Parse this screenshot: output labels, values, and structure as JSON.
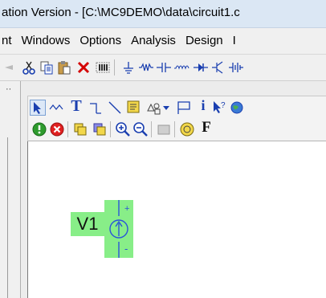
{
  "window": {
    "title": "ation Version - [C:\\MC9DEMO\\data\\circuit1.c"
  },
  "menu": {
    "items": [
      "nt",
      "Windows",
      "Options",
      "Analysis",
      "Design",
      "I"
    ]
  },
  "toolbar_main": {
    "icons": [
      "undo-icon",
      "cut-icon",
      "copy-icon",
      "paste-icon",
      "delete-icon",
      "select-all-icon",
      "ground-icon",
      "resistor-icon",
      "capacitor-icon",
      "inductor-icon",
      "diode-icon",
      "npn-transistor-icon",
      "battery-icon"
    ]
  },
  "toolbar_draw": {
    "icons": [
      "select-arrow-icon",
      "wire-icon",
      "text-icon",
      "wire-bend-icon",
      "line-icon",
      "graphics-icon",
      "flag-icon",
      "dropdown-icon",
      "pin-icon",
      "info-icon",
      "help-pointer-icon",
      "globe-icon"
    ],
    "text_tool_label": "T",
    "info_label": "i"
  },
  "toolbar_edit": {
    "icons": [
      "run-green-icon",
      "stop-red-icon",
      "copy-block-icon",
      "paste-block-icon",
      "zoom-in-icon",
      "zoom-out-icon",
      "disabled-icon",
      "component-icon",
      "font-icon"
    ],
    "font_label": "F"
  },
  "left_panel": {
    "mark": "··"
  },
  "component": {
    "name": "V1",
    "symbol": "current-source-icon",
    "plus_label": "+",
    "minus_label": "-",
    "highlight_color": "#88ee88"
  }
}
